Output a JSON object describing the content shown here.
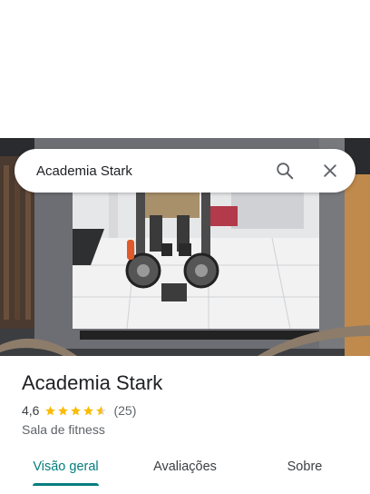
{
  "search": {
    "query": "Academia Stark",
    "icons": {
      "search": "search-icon",
      "close": "close-icon"
    }
  },
  "place": {
    "title": "Academia Stark",
    "rating_value": "4,6",
    "rating_stars": 4.6,
    "rating_count": "(25)",
    "category": "Sala de fitness"
  },
  "tabs": [
    {
      "label": "Visão geral",
      "active": true
    },
    {
      "label": "Avaliações",
      "active": false
    },
    {
      "label": "Sobre",
      "active": false
    }
  ],
  "colors": {
    "accent": "#067d7d",
    "star": "#fbbc04",
    "star_empty": "#dadce0"
  }
}
